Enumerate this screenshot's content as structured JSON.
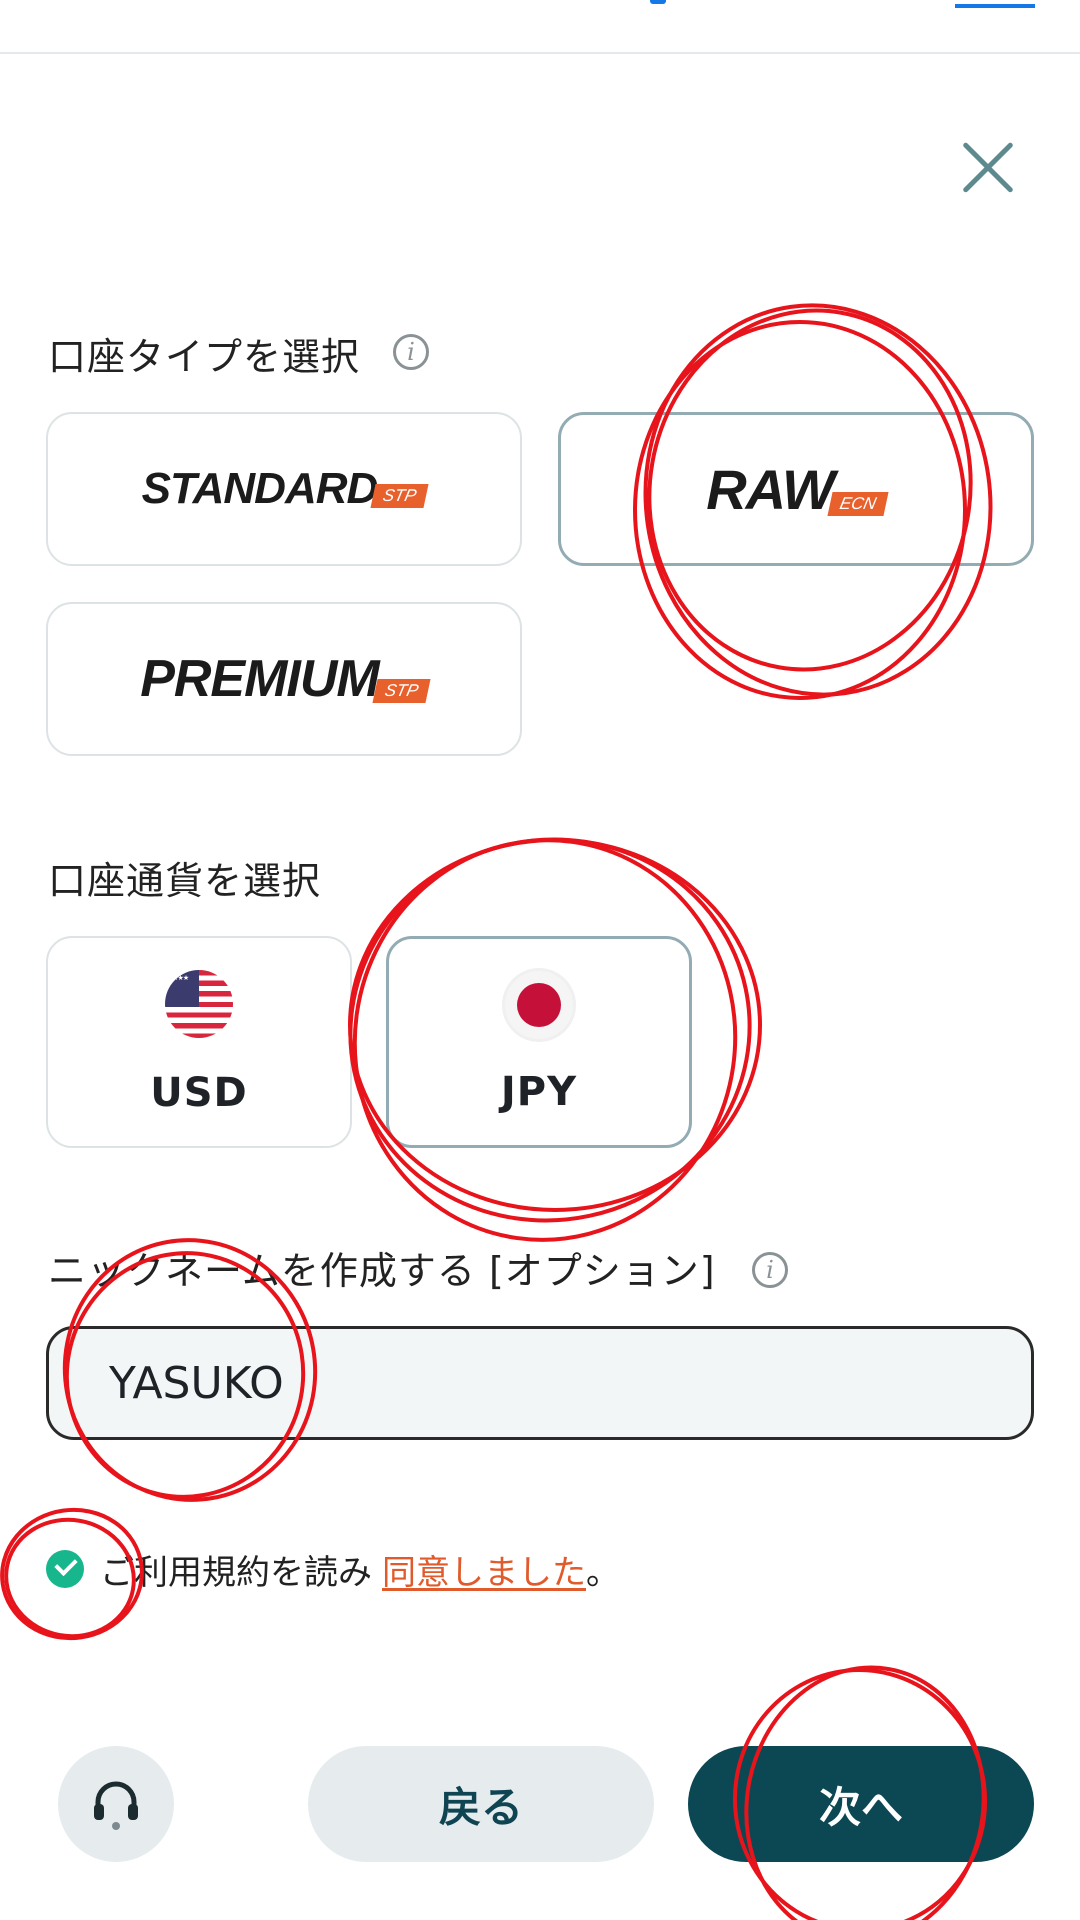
{
  "account_type": {
    "label": "口座タイプを選択",
    "options": [
      {
        "name": "STANDARD",
        "tag": "STP",
        "selected": false
      },
      {
        "name": "RAW",
        "tag": "ECN",
        "selected": true
      },
      {
        "name": "PREMIUM",
        "tag": "STP",
        "selected": false
      }
    ]
  },
  "currency": {
    "label": "口座通貨を選択",
    "options": [
      {
        "code": "USD",
        "flag": "us-flag-icon",
        "selected": false
      },
      {
        "code": "JPY",
        "flag": "jp-flag-icon",
        "selected": true
      }
    ]
  },
  "nickname": {
    "label": "ニックネームを作成する [オプション]",
    "value": "YASUKO"
  },
  "terms": {
    "checked": true,
    "text": "ご利用規約を読み",
    "link": "同意しました",
    "suffix": "。"
  },
  "buttons": {
    "back": "戻る",
    "next": "次へ"
  },
  "colors": {
    "primary": "#0b4853",
    "accent": "#e8602c",
    "check": "#17b68c",
    "annotation": "#e8141c"
  }
}
